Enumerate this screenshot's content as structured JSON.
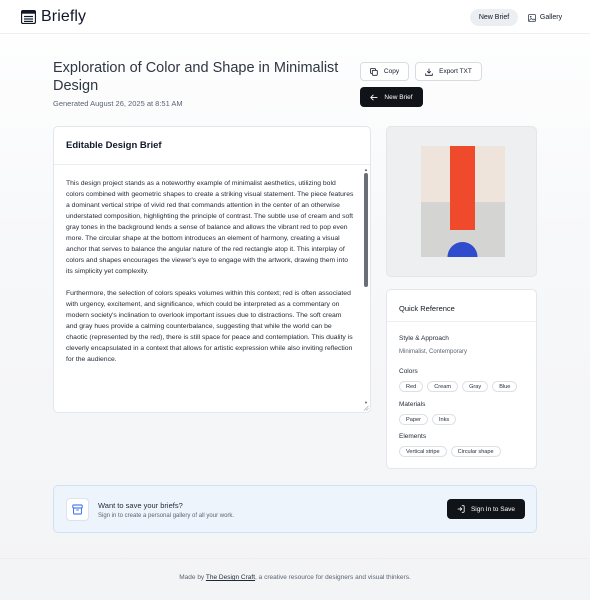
{
  "header": {
    "brand": "Briefly",
    "brand_icon": "list-document-icon",
    "nav": {
      "new_brief": "New Brief",
      "gallery": "Gallery",
      "gallery_icon": "gallery-icon"
    }
  },
  "brief": {
    "title": "Exploration of Color and Shape in Minimalist Design",
    "generated": "Generated August 26, 2025 at 8:51 AM",
    "actions": {
      "copy": "Copy",
      "export": "Export TXT",
      "new_brief": "New Brief"
    }
  },
  "editor": {
    "heading": "Editable Design Brief",
    "paragraphs": [
      "This design project stands as a noteworthy example of minimalist aesthetics, utilizing bold colors combined with geometric shapes to create a striking visual statement. The piece features a dominant vertical stripe of vivid red that commands attention in the center of an otherwise understated composition, highlighting the principle of contrast. The subtle use of cream and soft gray tones in the background lends a sense of balance and allows the vibrant red to pop even more. The circular shape at the bottom introduces an element of harmony, creating a visual anchor that serves to balance the angular nature of the red rectangle atop it. This interplay of colors and shapes encourages the viewer's eye to engage with the artwork, drawing them into its simplicity yet complexity.",
      "Furthermore, the selection of colors speaks volumes within this context; red is often associated with urgency, excitement, and significance, which could be interpreted as a commentary on modern society's inclination to overlook important issues due to distractions. The soft cream and gray hues provide a calming counterbalance, suggesting that while the world can be chaotic (represented by the red), there is still space for peace and contemplation. This duality is cleverly encapsulated in a context that allows for artistic expression while also inviting reflection for the audience."
    ]
  },
  "artwork": {
    "colors": {
      "cream": "#efe4dc",
      "gray": "#d4d4d2",
      "red": "#ef4a2b",
      "blue": "#2f4ccc"
    }
  },
  "quick_reference": {
    "title": "Quick Reference",
    "style_label": "Style & Approach",
    "style_value": "Minimalist, Contemporary",
    "colors_label": "Colors",
    "colors": [
      "Red",
      "Cream",
      "Gray",
      "Blue"
    ],
    "materials_label": "Materials",
    "materials": [
      "Paper",
      "Inks"
    ],
    "elements_label": "Elements",
    "elements": [
      "Vertical stripe",
      "Circular shape"
    ]
  },
  "save_banner": {
    "title": "Want to save your briefs?",
    "subtitle": "Sign in to create a personal gallery of all your work.",
    "button": "Sign In to Save"
  },
  "footer": {
    "prefix": "Made by",
    "link": "The Design Craft",
    "suffix": ", a creative resource for designers and visual thinkers."
  }
}
